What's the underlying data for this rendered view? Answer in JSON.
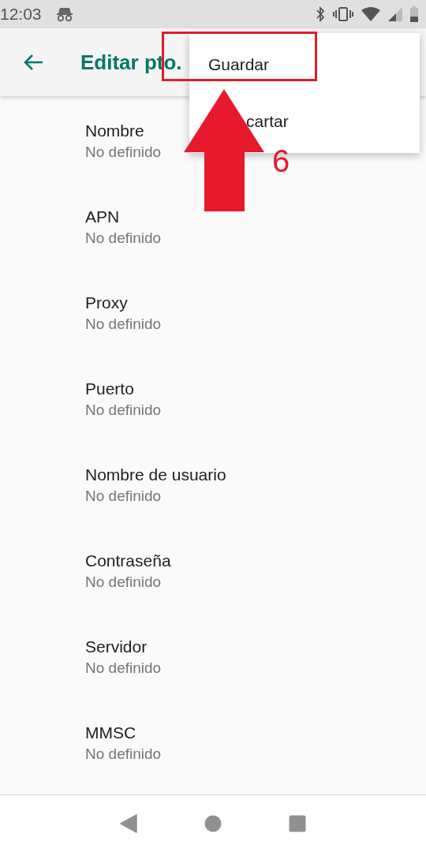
{
  "status_bar": {
    "time": "12:03"
  },
  "toolbar": {
    "title": "Editar pto."
  },
  "overflow_menu": {
    "items": [
      {
        "label": "Guardar",
        "highlighted": true
      },
      {
        "label": "cartar",
        "highlighted": false
      }
    ]
  },
  "annotation": {
    "step": "6"
  },
  "settings": [
    {
      "title": "Nombre",
      "summary": "No definido"
    },
    {
      "title": "APN",
      "summary": "No definido"
    },
    {
      "title": "Proxy",
      "summary": "No definido"
    },
    {
      "title": "Puerto",
      "summary": "No definido"
    },
    {
      "title": "Nombre de usuario",
      "summary": "No definido"
    },
    {
      "title": "Contraseña",
      "summary": "No definido"
    },
    {
      "title": "Servidor",
      "summary": "No definido"
    },
    {
      "title": "MMSC",
      "summary": "No definido"
    }
  ]
}
